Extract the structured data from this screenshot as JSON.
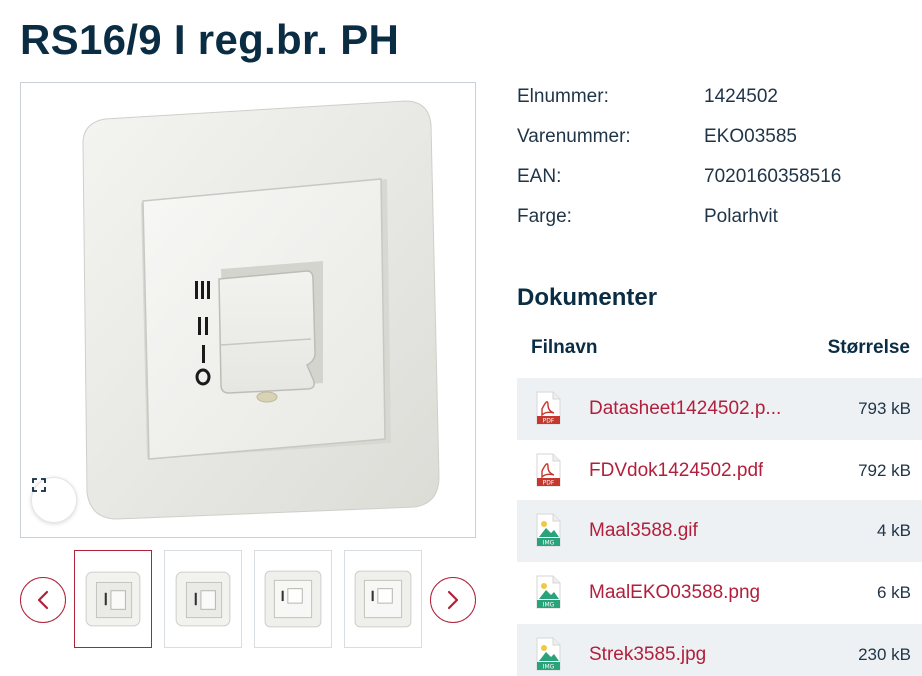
{
  "product": {
    "title": "RS16/9 I reg.br. PH"
  },
  "specs": [
    {
      "label": "Elnummer:",
      "value": "1424502"
    },
    {
      "label": "Varenummer:",
      "value": "EKO03585"
    },
    {
      "label": "EAN:",
      "value": "7020160358516"
    },
    {
      "label": "Farge:",
      "value": "Polarhvit"
    }
  ],
  "documents": {
    "title": "Dokumenter",
    "header_name": "Filnavn",
    "header_size": "Størrelse",
    "files": [
      {
        "name": "Datasheet1424502.p...",
        "size": "793 kB",
        "icon": "pdf-icon",
        "icon_label": "PDF"
      },
      {
        "name": "FDVdok1424502.pdf",
        "size": "792 kB",
        "icon": "pdf-icon",
        "icon_label": "PDF"
      },
      {
        "name": "Maal3588.gif",
        "size": "4 kB",
        "icon": "image-file-icon",
        "icon_label": "IMG"
      },
      {
        "name": "MaalEKO03588.png",
        "size": "6 kB",
        "icon": "image-file-icon",
        "icon_label": "IMG"
      },
      {
        "name": "Strek3585.jpg",
        "size": "230 kB",
        "icon": "image-file-icon",
        "icon_label": "IMG"
      }
    ]
  },
  "switch_markings": [
    "III",
    "II",
    "I",
    "O"
  ],
  "gallery": {
    "thumbnail_count": 4,
    "active_index": 0,
    "prev_icon": "chevron-left-icon",
    "next_icon": "chevron-right-icon",
    "expand_icon": "expand-icon"
  },
  "colors": {
    "title": "#0b2d44",
    "accent": "#b21f3c",
    "row_alt": "#edf1f4",
    "pdf_red": "#c8372d",
    "img_green": "#2aa37a"
  }
}
